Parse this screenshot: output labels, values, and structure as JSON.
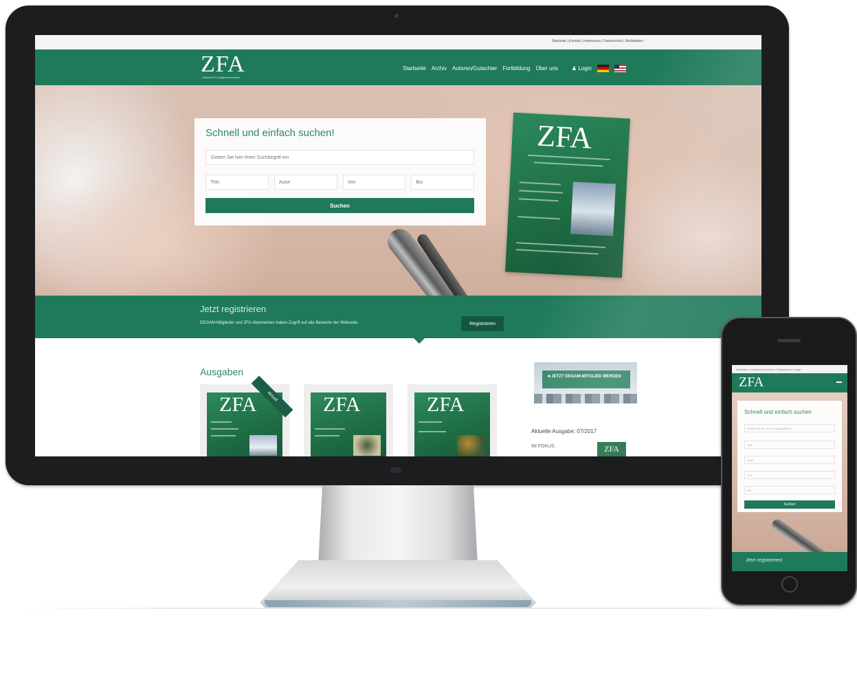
{
  "desktop": {
    "topbar_links": "Startseite | Kontakt | Impressum | Datenschutz | Mediadaten",
    "header": {
      "logo": "ZFA",
      "logo_subtitle": "Zeitschrift für Allgemeinmedizin",
      "nav": [
        "Startseite",
        "Archiv",
        "Autoren/Gutachter",
        "Fortbildung",
        "Über uns"
      ],
      "login": "Login"
    },
    "hero": {
      "search_title": "Schnell und einfach suchen!",
      "search_placeholder": "Geben Sie hier Ihren Suchbegriff ein",
      "fields": [
        "Titel",
        "Autor",
        "Von",
        "Bis"
      ],
      "search_button": "Suchen",
      "cover_logo": "ZFA"
    },
    "register": {
      "title": "Jetzt registrieren",
      "text": "DEGAM-Mitglieder und ZFA-Abonnenten haben Zugriff auf alle Bereiche der Webseite.",
      "button": "Registrieren"
    },
    "issues": {
      "title": "Ausgaben",
      "ribbon": "Aktuell",
      "covers": [
        "ZFA",
        "ZFA",
        "ZFA"
      ]
    },
    "sidebar": {
      "member_banner": "JETZT DEGAM-MITGLIED WERDEN",
      "current_issue": "Aktuelle Ausgabe: 07/2017",
      "im_fokus": "IM FOKUS",
      "mini_cover": "ZFA"
    }
  },
  "phone": {
    "topbar": "Startseite | Kontakt | Impressum | Registrieren | Login",
    "logo": "ZFA",
    "search_title": "Schnell und einfach suchen",
    "search_placeholder": "Geben Sie hier Ihren Suchbegriff ein",
    "fields": [
      "Titel",
      "Autor",
      "Von",
      "Bis"
    ],
    "search_button": "Suchen",
    "register_title": "Jetzt registrieren!"
  },
  "colors": {
    "brand_green": "#1f7a5a",
    "dark_green": "#14573f",
    "heading_green": "#2c8566"
  }
}
